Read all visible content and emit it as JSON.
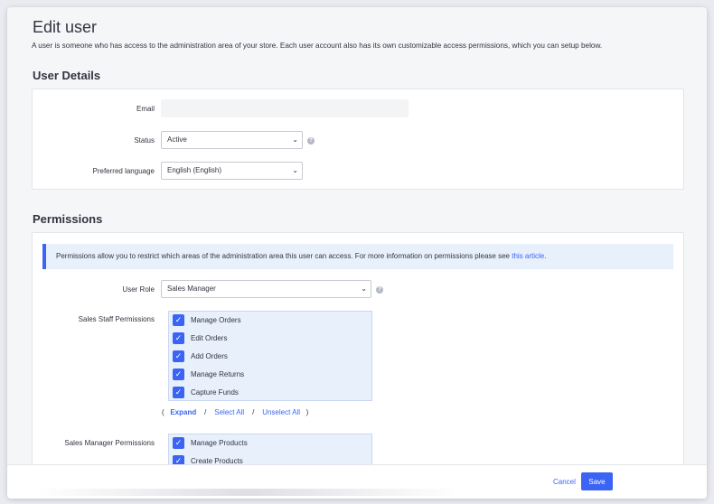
{
  "page": {
    "title": "Edit user",
    "description": "A user is someone who has access to the administration area of your store. Each user account also has its own customizable access permissions, which you can setup below."
  },
  "user_details": {
    "section_title": "User Details",
    "email_label": "Email",
    "email_value": "",
    "status_label": "Status",
    "status_value": "Active",
    "language_label": "Preferred language",
    "language_value": "English (English)"
  },
  "permissions": {
    "section_title": "Permissions",
    "notice_text": "Permissions allow you to restrict which areas of the administration area this user can access. For more information on permissions please see ",
    "notice_link": "this article",
    "notice_end": ".",
    "role_label": "User Role",
    "role_value": "Sales Manager",
    "sales_staff": {
      "label": "Sales Staff Permissions",
      "items": [
        "Manage Orders",
        "Edit Orders",
        "Add Orders",
        "Manage Returns",
        "Capture Funds"
      ]
    },
    "links": {
      "open": "(",
      "expand": "Expand",
      "sep1": "/",
      "select_all": "Select All",
      "sep2": "/",
      "unselect_all": "Unselect All",
      "close": ")"
    },
    "sales_manager": {
      "label": "Sales Manager Permissions",
      "items": [
        "Manage Products",
        "Create Products"
      ]
    }
  },
  "footer": {
    "cancel_label": "Cancel",
    "save_label": "Save"
  },
  "colors": {
    "accent": "#3c64f4",
    "notice_bg": "#e8f0fc"
  },
  "icons": {
    "help": "help-circle-icon",
    "check": "checkmark-icon",
    "dropdown": "chevron-down-icon"
  }
}
